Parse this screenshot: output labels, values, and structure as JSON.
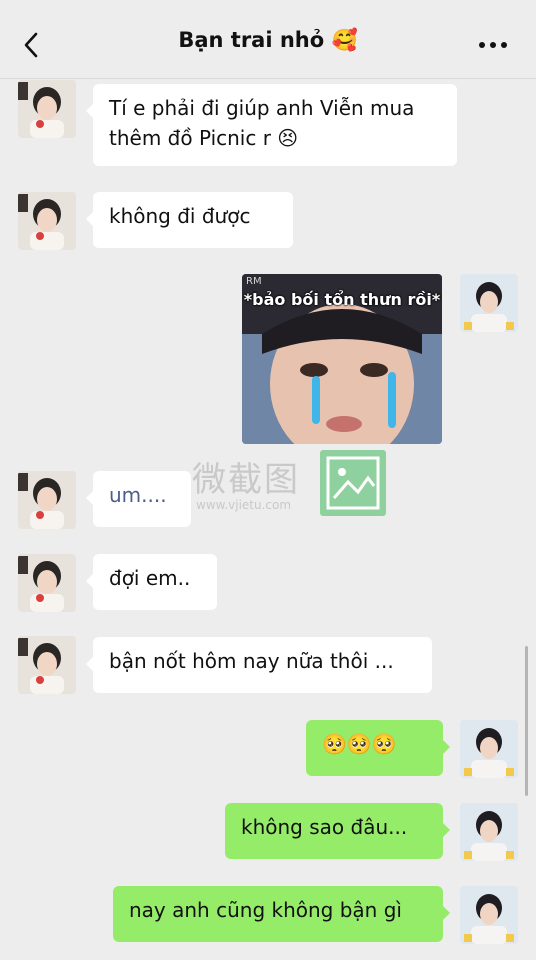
{
  "header": {
    "title": "Bạn trai nhỏ 🥰",
    "back_icon": "chevron-left-icon",
    "more_icon": "more-dots-icon"
  },
  "messages": [
    {
      "side": "in",
      "text_line1": "Tí e phải đi giúp anh Viễn mua",
      "text_line2": "thêm đồ Picnic r 😣"
    },
    {
      "side": "in",
      "text": "không đi được"
    },
    {
      "side": "out",
      "type": "sticker",
      "caption": "*bảo bối tổn thưn rồi*",
      "corner_mark": "RM"
    },
    {
      "side": "in",
      "text": "um...."
    },
    {
      "side": "in",
      "text": "đợi em.."
    },
    {
      "side": "in",
      "text": "bận nốt hôm nay nữa thôi ..."
    },
    {
      "side": "out",
      "text": "🥺🥺🥺"
    },
    {
      "side": "out",
      "text": "không sao đâu..."
    },
    {
      "side": "out",
      "text": "nay anh cũng không bận gì"
    }
  ],
  "watermark": {
    "chinese": "微截图",
    "url": "www.vjietu.com"
  },
  "colors": {
    "background": "#ededed",
    "incoming_bubble": "#ffffff",
    "outgoing_bubble": "#95ec69"
  }
}
